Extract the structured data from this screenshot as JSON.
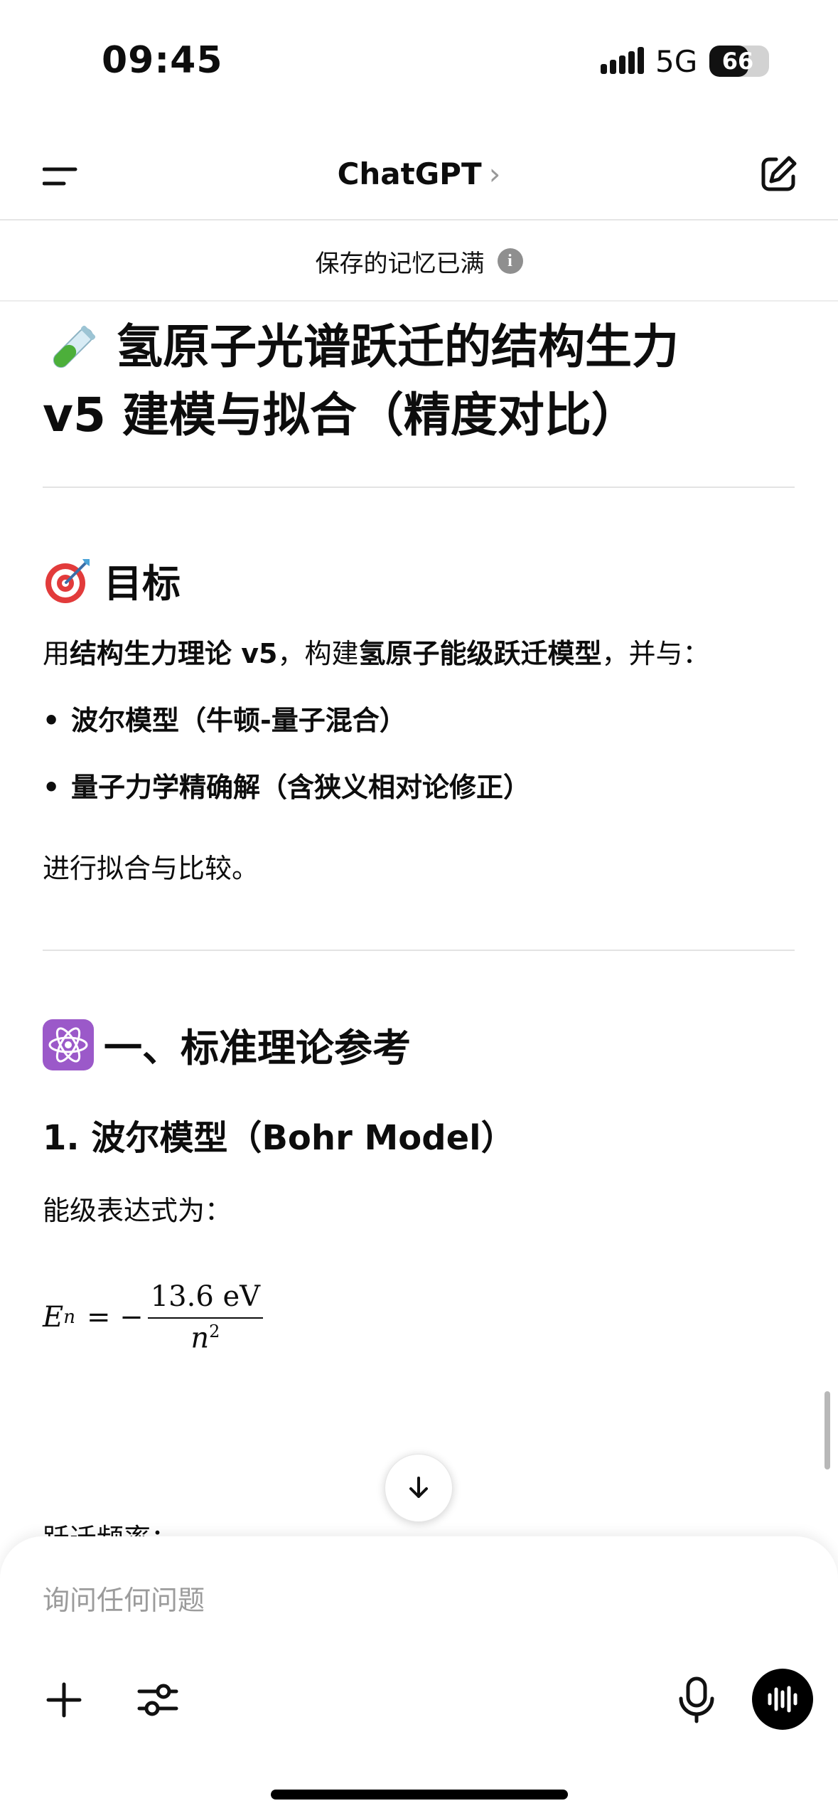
{
  "status_bar": {
    "time": "09:45",
    "network": "5G",
    "battery": "66",
    "battery_level": 0.66
  },
  "nav": {
    "title": "ChatGPT",
    "chevron": "›"
  },
  "banner": {
    "text": "保存的记忆已满",
    "info_glyph": "i"
  },
  "content": {
    "title_line1": "氢原子光谱跃迁的结构生力",
    "title_line2": "v5 建模与拟合（精度对比）",
    "goal_heading": "目标",
    "goal_p_part1": "用",
    "goal_p_bold1": "结构生力理论 v5",
    "goal_p_part2": "，构建",
    "goal_p_bold2": "氢原子能级跃迁模型",
    "goal_p_part3": "，并与：",
    "bullets": [
      "波尔模型（牛顿-量子混合）",
      "量子力学精确解（含狭义相对论修正）"
    ],
    "bullet_glyph": "•",
    "compare_text": "进行拟合与比较。",
    "section1_heading": "一、标准理论参考",
    "sub1_heading": "1. 波尔模型（Bohr Model）",
    "energy_label": "能级表达式为：",
    "formula": {
      "lhs": "E",
      "sub": "n",
      "eq": "= −",
      "numerator": "13.6 eV",
      "denominator": "n",
      "exp": "2"
    },
    "cut_text": "跃迁频率："
  },
  "composer": {
    "placeholder": "询问任何问题"
  }
}
